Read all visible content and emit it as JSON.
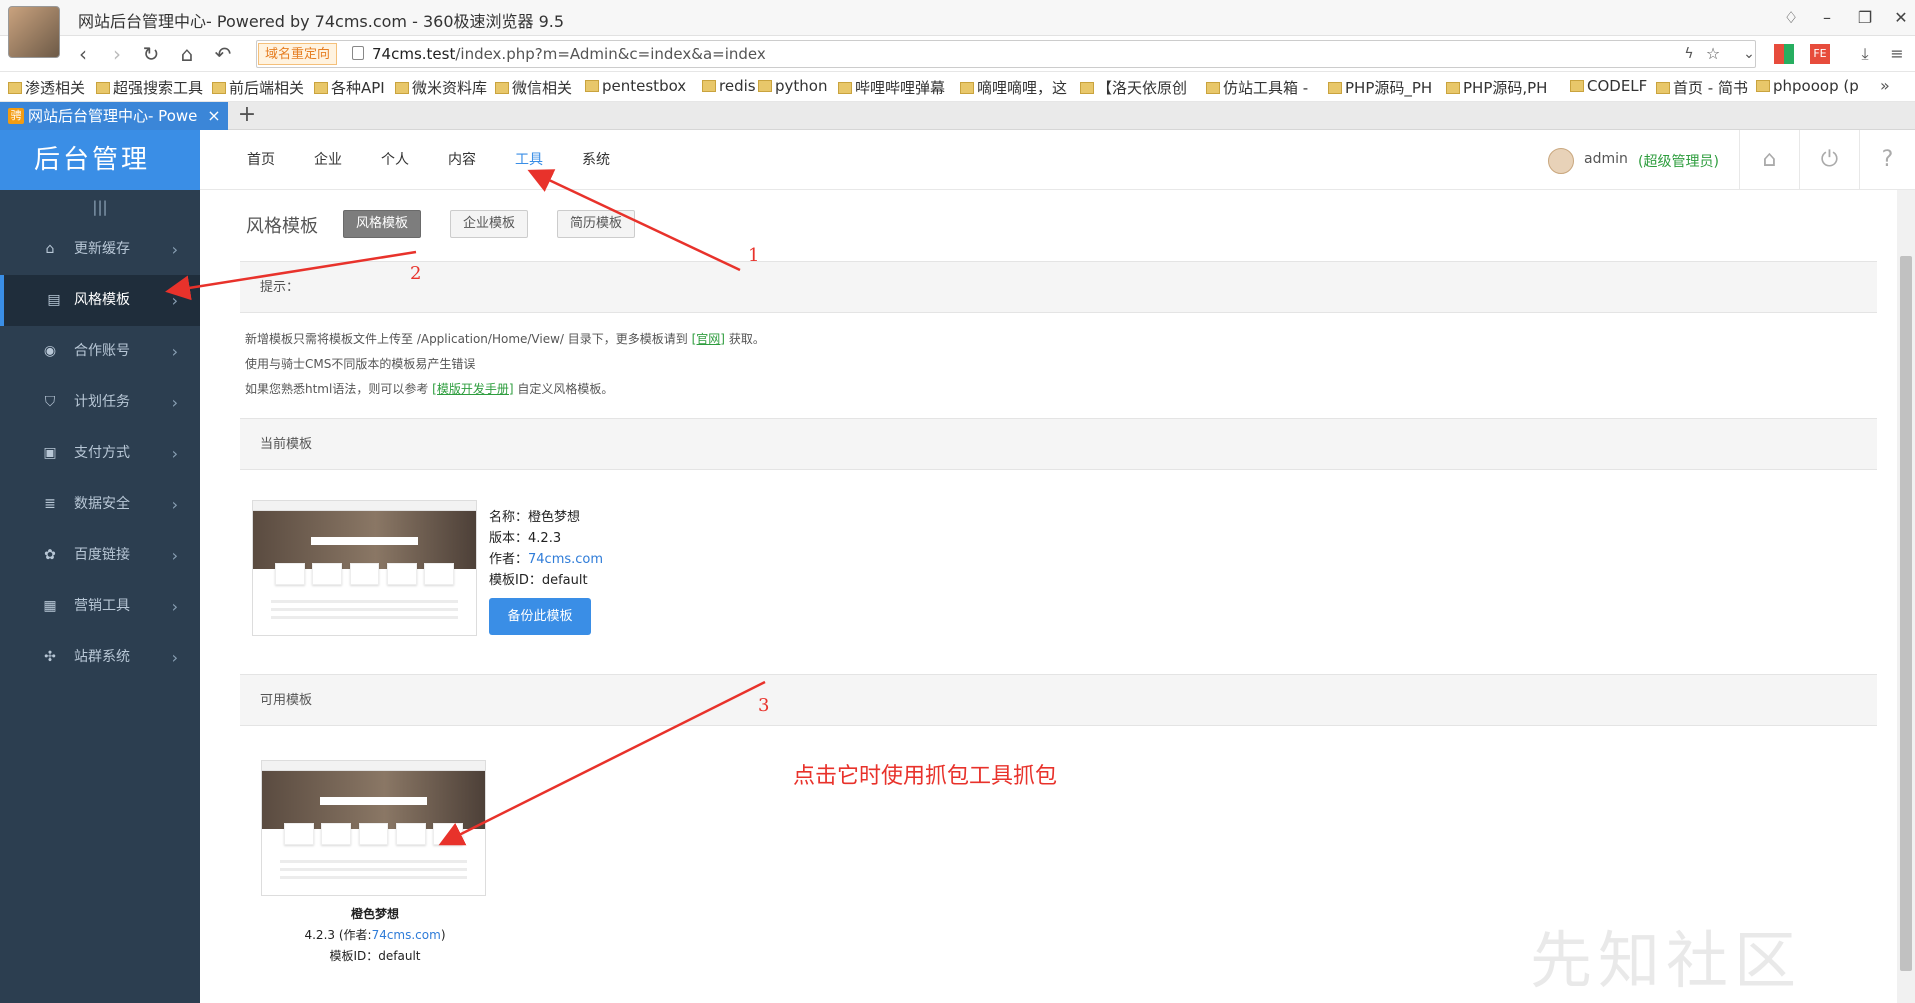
{
  "browser": {
    "title": "网站后台管理中心- Powered by 74cms.com - 360极速浏览器 9.5",
    "redirect_badge": "域名重定向",
    "url_host": "74cms.test",
    "url_path": "/index.php?m=Admin&c=index&a=index",
    "bookmarks": [
      "渗透相关",
      "超强搜索工具",
      "前后端相关",
      "各种API",
      "微米资料库",
      "微信相关",
      "pentestbox",
      "redis",
      "python",
      "哔哩哔哩弹幕",
      "嘀哩嘀哩，这",
      "【洛天依原创",
      "仿站工具箱 -",
      "PHP源码_PH",
      "PHP源码,PH",
      "CODELF",
      "首页 - 简书",
      "phpooop (p"
    ],
    "tab_title": "网站后台管理中心- Powe",
    "tab_favicon": "骋"
  },
  "sidebar": {
    "logo": "后台管理",
    "collapse_glyph": "|||",
    "items": [
      {
        "label": "更新缓存",
        "icon": "cache-icon"
      },
      {
        "label": "风格模板",
        "icon": "template-icon"
      },
      {
        "label": "合作账号",
        "icon": "weibo-icon"
      },
      {
        "label": "计划任务",
        "icon": "shield-icon"
      },
      {
        "label": "支付方式",
        "icon": "payment-icon"
      },
      {
        "label": "数据安全",
        "icon": "database-icon"
      },
      {
        "label": "百度链接",
        "icon": "paw-icon"
      },
      {
        "label": "营销工具",
        "icon": "marketing-icon"
      },
      {
        "label": "站群系统",
        "icon": "cluster-icon"
      }
    ],
    "active_index": 1
  },
  "topnav": {
    "items": [
      "首页",
      "企业",
      "个人",
      "内容",
      "工具",
      "系统"
    ],
    "active_index": 4,
    "user": "admin",
    "role": "(超级管理员)"
  },
  "page": {
    "heading": "风格模板",
    "subtabs": [
      "风格模板",
      "企业模板",
      "简历模板"
    ],
    "tips_title": "提示：",
    "tip1_pre": "新增模板只需将模板文件上传至 /Application/Home/View/ 目录下，更多模板请到",
    "tip1_link": "[官网]",
    "tip1_post": "获取。",
    "tip2": "使用与骑士CMS不同版本的模板易产生错误",
    "tip3_pre": "如果您熟悉html语法，则可以参考",
    "tip3_link": "[模版开发手册]",
    "tip3_post": "自定义风格模板。",
    "current_title": "当前模板",
    "current": {
      "name_label": "名称：",
      "name": "橙色梦想",
      "version_label": "版本：",
      "version": "4.2.3",
      "author_label": "作者：",
      "author": "74cms.com",
      "id_label": "模板ID：",
      "id": "default",
      "backup_btn": "备份此模板"
    },
    "available_title": "可用模板",
    "available": {
      "name": "橙色梦想",
      "version_pre": "4.2.3 (作者:",
      "author": "74cms.com",
      "version_post": ")",
      "id_line": "模板ID：default"
    }
  },
  "annotations": {
    "n1": "1",
    "n2": "2",
    "n3": "3",
    "text": "点击它时使用抓包工具抓包",
    "color": "#e8322b"
  },
  "watermark": "先知社区",
  "colors": {
    "accent": "#3a8ee6",
    "sidebar": "#2c3e50",
    "role": "#2e9d3e"
  }
}
